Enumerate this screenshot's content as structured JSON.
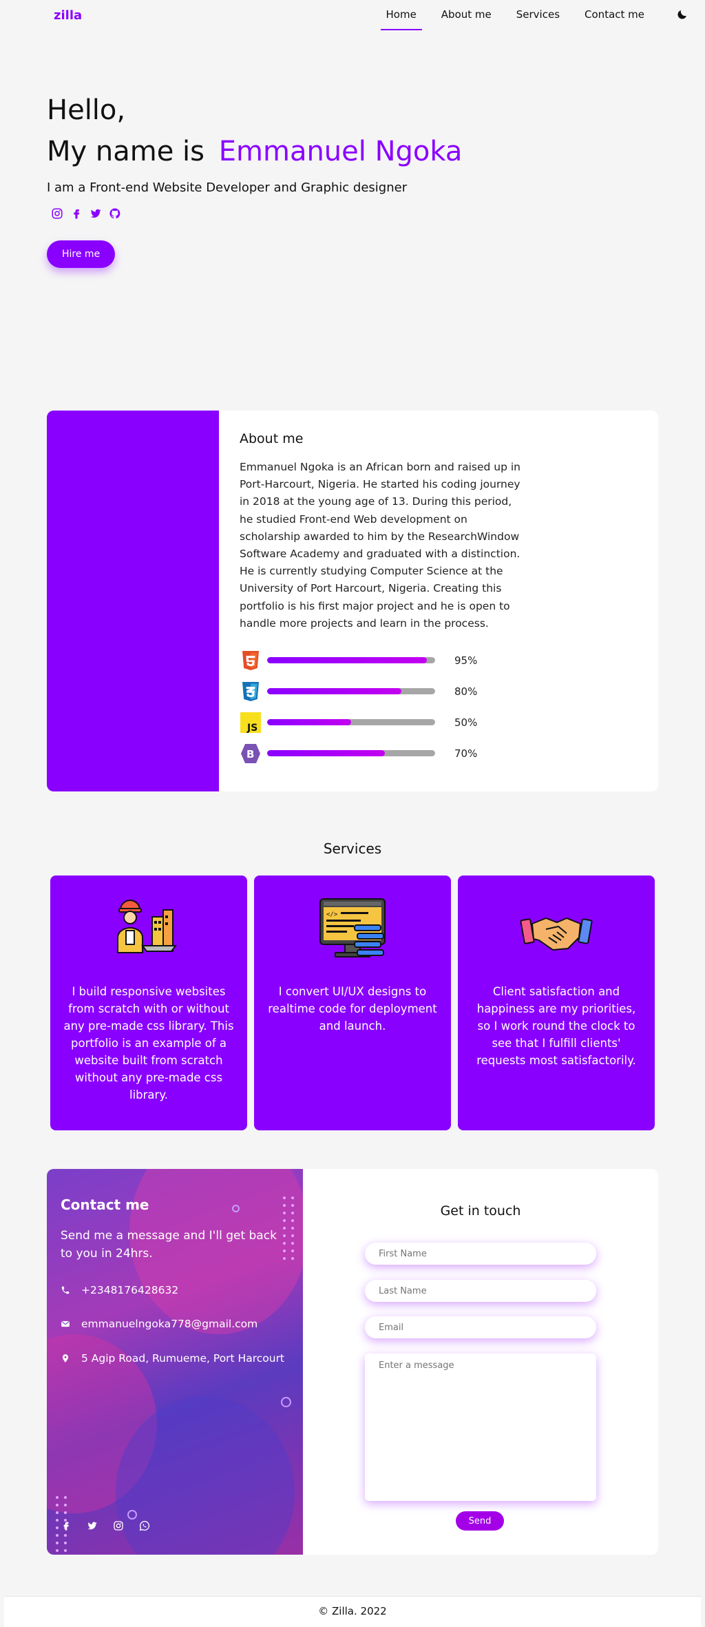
{
  "nav": {
    "logo": "zilla",
    "links": [
      {
        "label": "Home",
        "active": true
      },
      {
        "label": "About me",
        "active": false
      },
      {
        "label": "Services",
        "active": false
      },
      {
        "label": "Contact me",
        "active": false
      }
    ],
    "theme_icon": "moon-icon"
  },
  "hero": {
    "hello": "Hello,",
    "name_prefix": "My name is",
    "name": "Emmanuel Ngoka",
    "tagline": "I am a Front-end Website Developer and Graphic designer",
    "socials": [
      "instagram-icon",
      "facebook-icon",
      "twitter-icon",
      "github-icon"
    ],
    "cta": "Hire me"
  },
  "about": {
    "title": "About me",
    "text": "Emmanuel Ngoka is an African born and raised up in Port-Harcourt, Nigeria. He started his coding journey in 2018 at the young age of 13. During this period, he studied Front-end Web development on scholarship awarded to him by the ResearchWindow Software Academy and graduated with a distinction. He is currently studying Computer Science at the University of Port Harcourt, Nigeria. Creating this portfolio is his first major project and he is open to handle more projects and learn in the process.",
    "skills": [
      {
        "icon": "html5-icon",
        "percent_label": "95%",
        "value": 0.95
      },
      {
        "icon": "css3-icon",
        "percent_label": "80%",
        "value": 0.8
      },
      {
        "icon": "javascript-icon",
        "percent_label": "50%",
        "value": 0.5
      },
      {
        "icon": "bootstrap-icon",
        "percent_label": "70%",
        "value": 0.7
      }
    ]
  },
  "services": {
    "title": "Services",
    "items": [
      {
        "icon": "builder-icon",
        "text": "I build responsive websites from scratch with or without any pre-made css library. This portfolio is an example of a website built from scratch without any pre-made css library."
      },
      {
        "icon": "code-monitor-icon",
        "text": "I convert UI/UX designs to realtime code for deployment and launch."
      },
      {
        "icon": "handshake-icon",
        "text": "Client satisfaction and happiness are my priorities, so I work round the clock to see that I fulfill clients' requests most satisfactorily."
      }
    ]
  },
  "contact": {
    "title": "Contact me",
    "subtitle": "Send me a message and I'll get back to you in 24hrs.",
    "phone": "+2348176428632",
    "email": "emmanuelngoka778@gmail.com",
    "address": "5 Agip Road, Rumueme, Port Harcourt",
    "socials": [
      "facebook-icon",
      "twitter-icon",
      "instagram-icon",
      "whatsapp-icon"
    ],
    "form": {
      "title": "Get in touch",
      "first_name_placeholder": "First Name",
      "last_name_placeholder": "Last Name",
      "email_placeholder": "Email",
      "message_placeholder": "Enter a message",
      "send": "Send"
    }
  },
  "footer": {
    "text": "©  Zilla. 2022"
  },
  "colors": {
    "accent": "#8a00ff",
    "background": "#f5f5f5",
    "skill_track": "#a6a6a6"
  }
}
